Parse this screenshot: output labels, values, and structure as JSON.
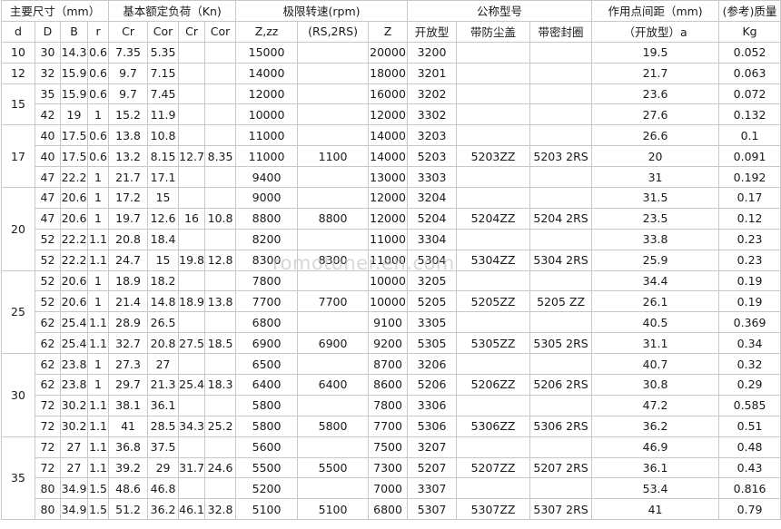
{
  "header": {
    "main_dims": "主要尺寸（mm）",
    "load_ratings": "基本额定负荷（Kn)",
    "speed_limit": "极限转速(rpm)",
    "nominal_model": "公称型号",
    "action_distance": "作用点间距（mm)",
    "ref_mass": "(参考)质量"
  },
  "subheader": [
    "d",
    "D",
    "B",
    "r",
    "Cr",
    "Cor",
    "Cr",
    "Cor",
    "Z,zz",
    "(RS,2RS)",
    "Z",
    "开放型",
    "带防尘盖",
    "带密封圈",
    "（开放型）a",
    "Kg"
  ],
  "groups": [
    {
      "d": "10",
      "rows": [
        [
          "30",
          "14.3",
          "0.6",
          "7.35",
          "5.35",
          "",
          "",
          "15000",
          "",
          "20000",
          "3200",
          "",
          "",
          "19.5",
          "0.052"
        ]
      ]
    },
    {
      "d": "12",
      "rows": [
        [
          "32",
          "15.9",
          "0.6",
          "9.7",
          "7.15",
          "",
          "",
          "14000",
          "",
          "18000",
          "3201",
          "",
          "",
          "21.7",
          "0.063"
        ]
      ]
    },
    {
      "d": "15",
      "rows": [
        [
          "35",
          "15.9",
          "0.6",
          "9.7",
          "7.45",
          "",
          "",
          "12000",
          "",
          "16000",
          "3202",
          "",
          "",
          "23.6",
          "0.072"
        ],
        [
          "42",
          "19",
          "1",
          "15.2",
          "11.9",
          "",
          "",
          "10000",
          "",
          "12000",
          "3302",
          "",
          "",
          "27.6",
          "0.132"
        ]
      ]
    },
    {
      "d": "17",
      "rows": [
        [
          "40",
          "17.5",
          "0.6",
          "13.8",
          "10.8",
          "",
          "",
          "11000",
          "",
          "14000",
          "3203",
          "",
          "",
          "26.6",
          "0.1"
        ],
        [
          "40",
          "17.5",
          "0.6",
          "13.2",
          "8.15",
          "12.7",
          "8.35",
          "11000",
          "1100",
          "14000",
          "5203",
          "5203ZZ",
          "5203 2RS",
          "20",
          "0.091"
        ],
        [
          "47",
          "22.2",
          "1",
          "21.7",
          "17.1",
          "",
          "",
          "9400",
          "",
          "13000",
          "3303",
          "",
          "",
          "31",
          "0.192"
        ]
      ]
    },
    {
      "d": "20",
      "rows": [
        [
          "47",
          "20.6",
          "1",
          "17.2",
          "15",
          "",
          "",
          "9000",
          "",
          "12000",
          "3204",
          "",
          "",
          "31.5",
          "0.17"
        ],
        [
          "47",
          "20.6",
          "1",
          "19.7",
          "12.6",
          "16",
          "10.8",
          "8800",
          "8800",
          "12000",
          "5204",
          "5204ZZ",
          "5204 2RS",
          "23.5",
          "0.12"
        ],
        [
          "52",
          "22.2",
          "1.1",
          "20.8",
          "18.4",
          "",
          "",
          "8200",
          "",
          "11000",
          "3304",
          "",
          "",
          "33.8",
          "0.23"
        ],
        [
          "52",
          "22.2",
          "1.1",
          "24.7",
          "15",
          "19.8",
          "12.8",
          "8300",
          "8300",
          "11000",
          "5304",
          "5304ZZ",
          "5304 2RS",
          "25.9",
          "0.23"
        ]
      ]
    },
    {
      "d": "25",
      "rows": [
        [
          "52",
          "20.6",
          "1",
          "18.9",
          "18.2",
          "",
          "",
          "7800",
          "",
          "10000",
          "3205",
          "",
          "",
          "34.4",
          "0.19"
        ],
        [
          "52",
          "20.6",
          "1",
          "21.4",
          "14.8",
          "18.9",
          "13.8",
          "7700",
          "7700",
          "10000",
          "5205",
          "5205ZZ",
          "5205 ZZ",
          "26.1",
          "0.19"
        ],
        [
          "62",
          "25.4",
          "1.1",
          "28.9",
          "26.5",
          "",
          "",
          "6800",
          "",
          "9100",
          "3305",
          "",
          "",
          "40.5",
          "0.369"
        ],
        [
          "62",
          "25.4",
          "1.1",
          "32.7",
          "20.8",
          "27.5",
          "18.5",
          "6900",
          "6900",
          "9200",
          "5305",
          "5305ZZ",
          "5305 2RS",
          "31.1",
          "0.34"
        ]
      ]
    },
    {
      "d": "30",
      "rows": [
        [
          "62",
          "23.8",
          "1",
          "27.3",
          "27",
          "",
          "",
          "6500",
          "",
          "8700",
          "3206",
          "",
          "",
          "40.7",
          "0.32"
        ],
        [
          "62",
          "23.8",
          "1",
          "29.7",
          "21.3",
          "25.4",
          "18.3",
          "6400",
          "6400",
          "8600",
          "5206",
          "5206ZZ",
          "5206 2RS",
          "30.8",
          "0.29"
        ],
        [
          "72",
          "30.2",
          "1.1",
          "38.1",
          "36.1",
          "",
          "",
          "5800",
          "",
          "7800",
          "3306",
          "",
          "",
          "47.2",
          "0.585"
        ],
        [
          "72",
          "30.2",
          "1.1",
          "41",
          "28.5",
          "34.3",
          "25.2",
          "5800",
          "5800",
          "7700",
          "5306",
          "5306ZZ",
          "5306 2RS",
          "36.2",
          "0.51"
        ]
      ]
    },
    {
      "d": "35",
      "rows": [
        [
          "72",
          "27",
          "1.1",
          "36.8",
          "37.5",
          "",
          "",
          "5600",
          "",
          "7500",
          "3207",
          "",
          "",
          "46.9",
          "0.48"
        ],
        [
          "72",
          "27",
          "1.1",
          "39.2",
          "29",
          "31.7",
          "24.6",
          "5500",
          "5500",
          "7300",
          "5207",
          "5207ZZ",
          "5207 2RS",
          "36.1",
          "0.43"
        ],
        [
          "80",
          "34.9",
          "1.5",
          "48.6",
          "46.8",
          "",
          "",
          "5200",
          "",
          "7000",
          "3307",
          "",
          "",
          "53.4",
          "0.816"
        ],
        [
          "80",
          "34.9",
          "1.5",
          "51.2",
          "36.2",
          "46.1",
          "32.8",
          "5100",
          "5100",
          "6800",
          "5307",
          "5307ZZ",
          "5307 2RS",
          "41",
          "0.79"
        ]
      ]
    }
  ],
  "watermark": "romotoner.en.com"
}
